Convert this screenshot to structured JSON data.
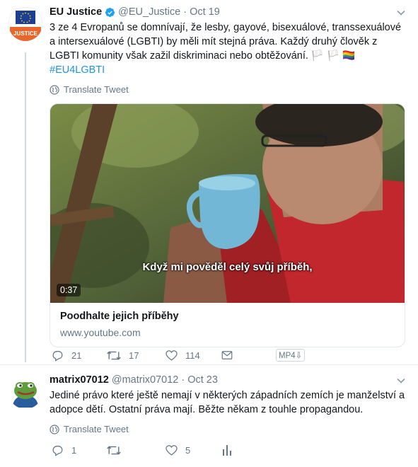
{
  "tweet1": {
    "display_name": "EU Justice",
    "handle": "@EU_Justice",
    "separator": "·",
    "date": "Oct 19",
    "avatar_text": "JUSTICE",
    "text_main": "3 ze 4 Evropanů se domnívají, že lesby, gayové, bisexuálové, transsexuálové a intersexuálové (LGBTI) by měli mít stejná práva. Každý druhý člověk z LGBTI komunity však zažil diskriminaci nebo obtěžování. 🏳️ 🏳️ 🏳️‍🌈",
    "hashtag": "#EU4LGBTI",
    "translate": "Translate Tweet",
    "video_subtitle": "Když mi pověděl celý svůj příběh,",
    "video_duration": "0:37",
    "card_title": "Poodhalte jejich příběhy",
    "card_url": "www.youtube.com",
    "replies": "21",
    "retweets": "17",
    "likes": "114",
    "mp4_label": "MP4⇩"
  },
  "tweet2": {
    "display_name": "matrix07012",
    "handle": "@matrix07012",
    "separator": "·",
    "date": "Oct 23",
    "text": "Jediné právo které ještě nemají v některých západních zemích je manželství a adopce dětí. Ostatní práva mají. Běžte někam z touhle propagandou.",
    "translate": "Translate Tweet",
    "replies": "1",
    "likes": "5"
  },
  "colors": {
    "link": "#1b95e0",
    "muted": "#657786",
    "text": "#14171a",
    "eu_blue": "#1c3f94",
    "eu_orange": "#e8672b"
  },
  "icons": [
    "caret-down-icon",
    "verified-badge-icon",
    "globe-icon",
    "reply-icon",
    "retweet-icon",
    "like-icon",
    "share-icon",
    "analytics-icon"
  ]
}
